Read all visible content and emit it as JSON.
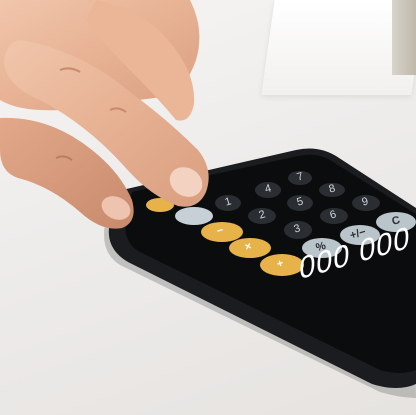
{
  "photo": {
    "subject": "hand pressing calculator app keys on a smartphone",
    "display_value": "000 000",
    "keys": {
      "minus": "−",
      "multiply": "×",
      "plus": "+",
      "percent": "%",
      "plus_minus": "+/−",
      "clear": "C",
      "seven": "7",
      "eight": "8",
      "nine": "9",
      "four": "4",
      "five": "5",
      "six": "6",
      "one": "1",
      "two": "2",
      "three": "3"
    },
    "colors": {
      "phone_body": "#1a1c1f",
      "operator_key": "#e8b24a",
      "function_key": "#b9c4cb",
      "number_key": "#2a2d31"
    }
  }
}
